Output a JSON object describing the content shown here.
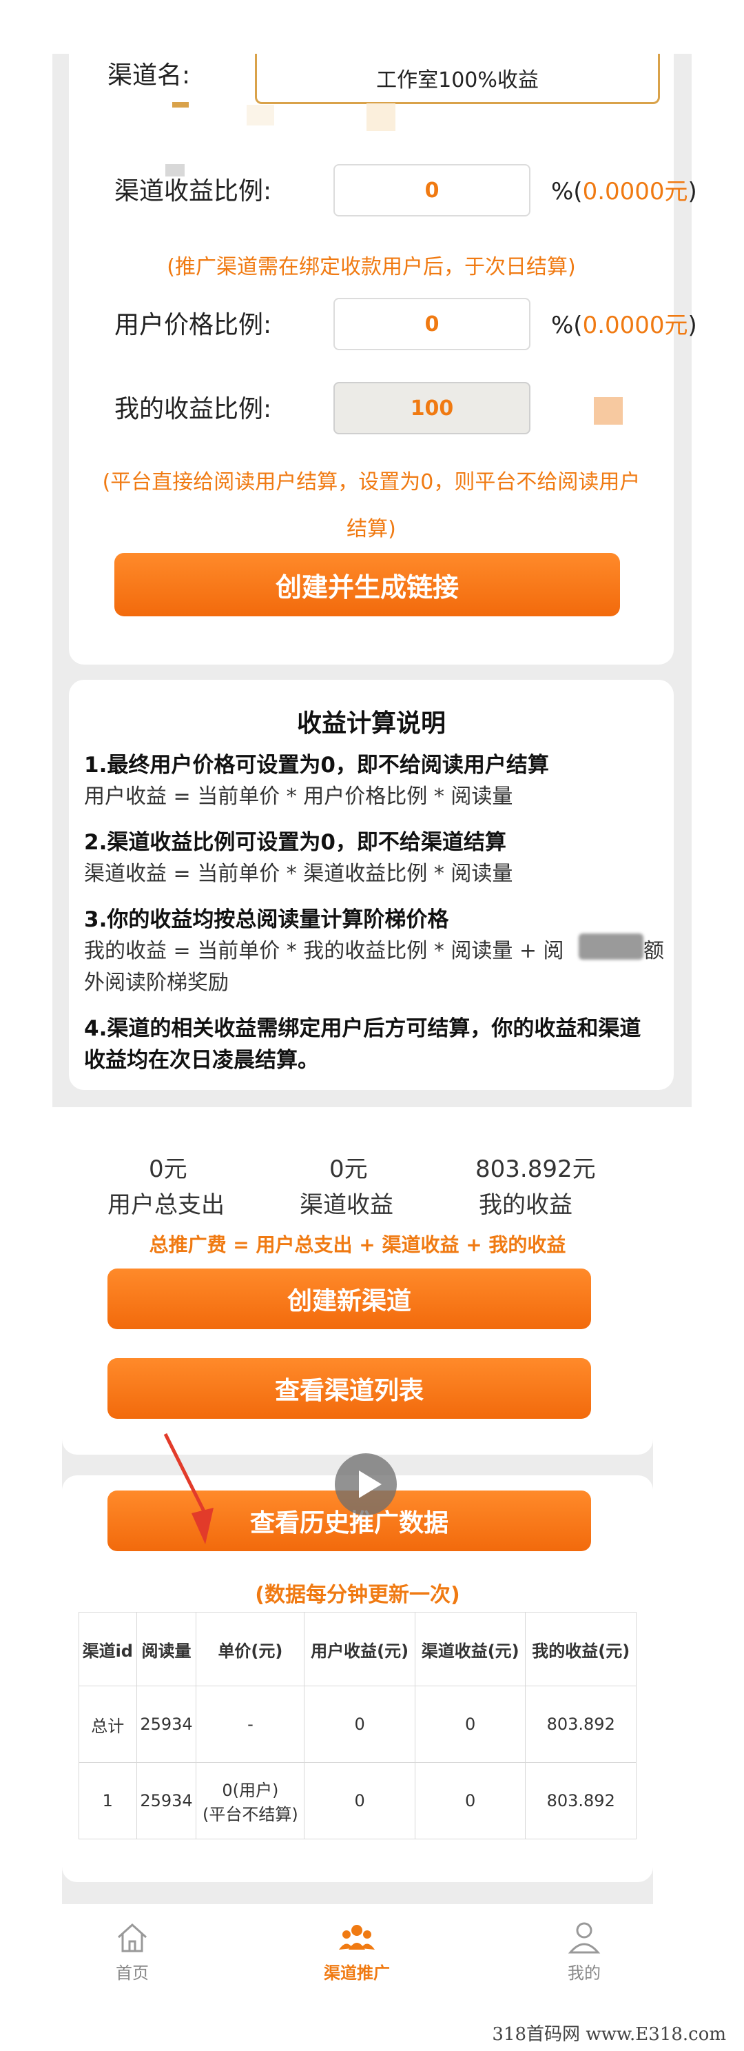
{
  "channel_form": {
    "name_label": "渠道名:",
    "name_value": "工作室100%收益",
    "channel_ratio_label": "渠道收益比例:",
    "channel_ratio_value": "0",
    "channel_unit": "%(",
    "channel_amount": "0.0000元",
    "channel_unit_close": ")",
    "channel_note": "(推广渠道需在绑定收款用户后，于次日结算)",
    "user_ratio_label": "用户价格比例:",
    "user_ratio_value": "0",
    "user_unit": "%(",
    "user_amount": "0.0000元",
    "user_unit_close": ")",
    "my_ratio_label": "我的收益比例:",
    "my_ratio_value": "100",
    "platform_note_line1": "(平台直接给阅读用户结算，设置为0，则平台不给阅读用户",
    "platform_note_line2": "结算)",
    "create_button": "创建并生成链接"
  },
  "explanation": {
    "title": "收益计算说明",
    "items": [
      {
        "heading": "1.最终用户价格可设置为0，即不给阅读用户结算",
        "text": "用户收益 = 当前单价 * 用户价格比例 * 阅读量"
      },
      {
        "heading": "2.渠道收益比例可设置为0，即不给渠道结算",
        "text": "渠道收益 = 当前单价 * 渠道收益比例 * 阅读量"
      },
      {
        "heading": "3.你的收益均按总阅读量计算阶梯价格",
        "text": "我的收益 = 当前单价 * 我的收益比例 * 阅读量 + 阅",
        "text_tail": "额",
        "text_line2": "外阅读阶梯奖励"
      },
      {
        "heading": "4.渠道的相关收益需绑定用户后方可结算，你的收益和渠道",
        "heading_line2": "收益均在次日凌晨结算。"
      }
    ]
  },
  "summary": {
    "stats": [
      {
        "value": "0元",
        "label": "用户总支出"
      },
      {
        "value": "0元",
        "label": "渠道收益"
      },
      {
        "value": "803.892元",
        "label": "我的收益"
      }
    ],
    "formula": "总推广费 = 用户总支出 + 渠道收益 + 我的收益",
    "new_channel_button": "创建新渠道",
    "channel_list_button": "查看渠道列表",
    "history_button": "查看历史推广数据",
    "update_note": "(数据每分钟更新一次)"
  },
  "table": {
    "headers": [
      "渠道id",
      "阅读量",
      "单价(元)",
      "用户收益(元)",
      "渠道收益(元)",
      "我的收益(元)"
    ],
    "rows": [
      [
        "总计",
        "25934",
        "-",
        "0",
        "0",
        "803.892"
      ],
      [
        "1",
        "25934",
        "0(用户)",
        "0",
        "0",
        "803.892"
      ]
    ],
    "row2_price_line2": "(平台不结算)"
  },
  "bottom_nav": [
    {
      "label": "首页",
      "icon": "home-icon"
    },
    {
      "label": "渠道推广",
      "icon": "group-icon"
    },
    {
      "label": "我的",
      "icon": "user-icon"
    }
  ],
  "colors": {
    "accent": "#f07a12",
    "button": "#f26a0c",
    "arrow": "#e23b2a"
  },
  "watermark": "318首码网 www.E318.com"
}
